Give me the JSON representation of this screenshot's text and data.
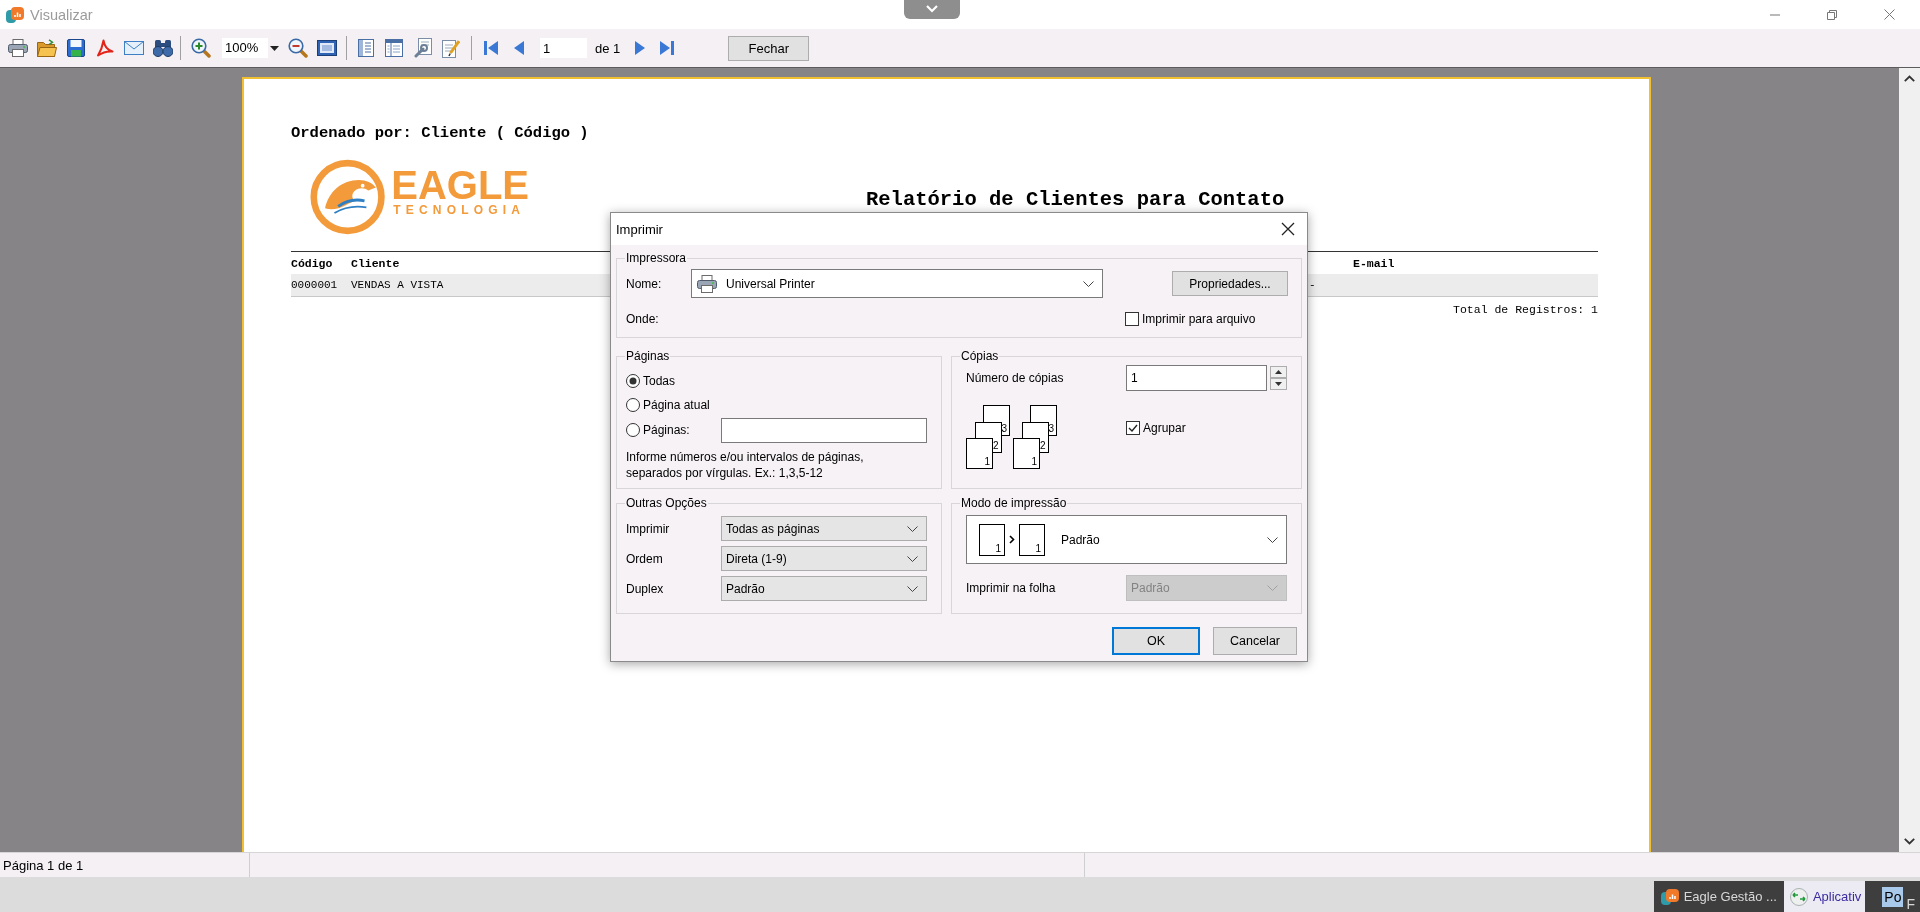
{
  "window": {
    "title": "Visualizar"
  },
  "toolbar": {
    "zoom": "100%",
    "page": "1",
    "page_count": "de 1",
    "close_button": "Fechar"
  },
  "report": {
    "sort_line": "Ordenado por: Cliente ( Código )",
    "logo": {
      "name": "EAGLE",
      "tagline": "TECNOLOGIA"
    },
    "title": "Relatório de Clientes para Contato",
    "columns": {
      "code": "Código",
      "client": "Cliente",
      "email": "E-mail"
    },
    "rows": [
      {
        "code": "0000001",
        "client": "VENDAS A VISTA",
        "column_3": "-"
      }
    ],
    "total": "Total de Registros: 1"
  },
  "dialog": {
    "title": "Imprimir",
    "printer": {
      "legend": "Impressora",
      "name_label": "Nome:",
      "name": "Universal Printer",
      "properties_button": "Propriedades...",
      "where_label": "Onde:",
      "print_to_file": {
        "label": "Imprimir para arquivo",
        "checked": false
      }
    },
    "pages": {
      "legend": "Páginas",
      "options": [
        {
          "kind": "plain",
          "label": "Todas",
          "selected": true
        },
        {
          "kind": "plain",
          "label": "Página atual",
          "selected": false
        },
        {
          "kind": "range",
          "label": "Páginas:",
          "selected": false
        }
      ],
      "hint": "Informe números e/ou intervalos de páginas, separados por vírgulas. Ex.: 1,3,5-12"
    },
    "copies": {
      "legend": "Cópias",
      "count_label": "Número de cópias",
      "count": "1",
      "stacks": [
        {
          "pages": [
            "1",
            "2",
            "3"
          ]
        },
        {
          "pages": [
            "1",
            "2",
            "3"
          ]
        }
      ],
      "collate": {
        "label": "Agrupar",
        "checked": true
      }
    },
    "other_options": {
      "legend": "Outras Opções",
      "fields": [
        {
          "label": "Imprimir",
          "value": "Todas as páginas"
        },
        {
          "label": "Ordem",
          "value": "Direta (1-9)"
        },
        {
          "label": "Duplex",
          "value": "Padrão"
        }
      ]
    },
    "print_mode": {
      "legend": "Modo de impressão",
      "mode": "Padrão",
      "sheet_pages": [
        "1",
        "1"
      ],
      "sheet_label": "Imprimir na folha",
      "sheet": {
        "value": "Padrão",
        "disabled": true
      }
    },
    "buttons": [
      {
        "label": "OK",
        "focused": true
      },
      {
        "label": "Cancelar",
        "focused": false
      }
    ]
  },
  "status_bar": {
    "page": "Página 1 de 1"
  },
  "taskbar": {
    "items": [
      {
        "kind": "eagle",
        "label": "Eagle Gestão ...",
        "selected": false
      },
      {
        "kind": "remote",
        "label": "Aplicativ",
        "selected": true
      },
      {
        "kind": "tile",
        "badge": "Po",
        "label": "F",
        "selected": false
      }
    ]
  }
}
